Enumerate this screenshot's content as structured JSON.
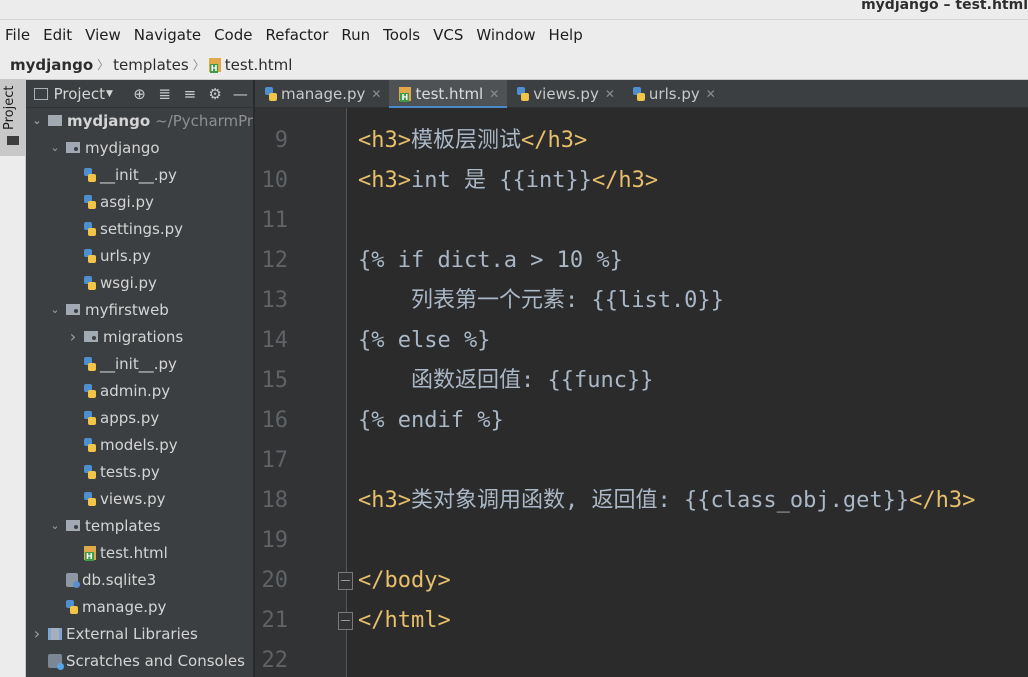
{
  "window": {
    "title": "mydjango – test.html"
  },
  "menu": [
    "File",
    "Edit",
    "View",
    "Navigate",
    "Code",
    "Refactor",
    "Run",
    "Tools",
    "VCS",
    "Window",
    "Help"
  ],
  "breadcrumb": {
    "project": "mydjango",
    "folder": "templates",
    "file": "test.html"
  },
  "toolstrip": {
    "project_label": "Project"
  },
  "project_panel": {
    "view_selector": "Project",
    "tree": [
      {
        "label": "mydjango",
        "path": "~/PycharmProj",
        "icon": "folder",
        "arrow": "expanded",
        "bold": true
      },
      {
        "label": "mydjango",
        "icon": "folder",
        "arrow": "expanded"
      },
      {
        "label": "__init__.py",
        "icon": "python-file"
      },
      {
        "label": "asgi.py",
        "icon": "python-file"
      },
      {
        "label": "settings.py",
        "icon": "python-file"
      },
      {
        "label": "urls.py",
        "icon": "python-file"
      },
      {
        "label": "wsgi.py",
        "icon": "python-file"
      },
      {
        "label": "myfirstweb",
        "icon": "folder",
        "arrow": "expanded"
      },
      {
        "label": "migrations",
        "icon": "folder",
        "arrow": "collapsed"
      },
      {
        "label": "__init__.py",
        "icon": "python-file"
      },
      {
        "label": "admin.py",
        "icon": "python-file"
      },
      {
        "label": "apps.py",
        "icon": "python-file"
      },
      {
        "label": "models.py",
        "icon": "python-file"
      },
      {
        "label": "tests.py",
        "icon": "python-file"
      },
      {
        "label": "views.py",
        "icon": "python-file"
      },
      {
        "label": "templates",
        "icon": "folder",
        "arrow": "expanded"
      },
      {
        "label": "test.html",
        "icon": "html-file"
      },
      {
        "label": "db.sqlite3",
        "icon": "database-file"
      },
      {
        "label": "manage.py",
        "icon": "python-file"
      },
      {
        "label": "External Libraries",
        "icon": "library",
        "arrow": "collapsed"
      },
      {
        "label": "Scratches and Consoles",
        "icon": "scratch"
      }
    ]
  },
  "tabs": [
    {
      "label": "manage.py",
      "icon": "python-file",
      "active": false
    },
    {
      "label": "test.html",
      "icon": "html-file",
      "active": true
    },
    {
      "label": "views.py",
      "icon": "python-file",
      "active": false
    },
    {
      "label": "urls.py",
      "icon": "python-file",
      "active": false
    }
  ],
  "editor": {
    "lines": [
      {
        "n": "9",
        "parts": [
          [
            "tag",
            "<h3>"
          ],
          [
            "text",
            "模板层测试"
          ],
          [
            "tag",
            "</h3>"
          ]
        ]
      },
      {
        "n": "10",
        "parts": [
          [
            "tag",
            "<h3>"
          ],
          [
            "text",
            "int 是 {{int}}"
          ],
          [
            "tag",
            "</h3>"
          ]
        ]
      },
      {
        "n": "11",
        "parts": []
      },
      {
        "n": "12",
        "parts": [
          [
            "text",
            "{% if dict.a > 10 %}"
          ]
        ]
      },
      {
        "n": "13",
        "parts": [
          [
            "text",
            "    列表第一个元素: {{list.0}}"
          ]
        ]
      },
      {
        "n": "14",
        "parts": [
          [
            "text",
            "{% else %}"
          ]
        ]
      },
      {
        "n": "15",
        "parts": [
          [
            "text",
            "    函数返回值: {{func}}"
          ]
        ]
      },
      {
        "n": "16",
        "parts": [
          [
            "text",
            "{% endif %}"
          ]
        ]
      },
      {
        "n": "17",
        "parts": []
      },
      {
        "n": "18",
        "parts": [
          [
            "tag",
            "<h3>"
          ],
          [
            "text",
            "类对象调用函数, 返回值: {{class_obj.get}}"
          ],
          [
            "tag",
            "</h3>"
          ]
        ]
      },
      {
        "n": "19",
        "parts": []
      },
      {
        "n": "20",
        "parts": [
          [
            "tag",
            "</body>"
          ]
        ],
        "fold": true
      },
      {
        "n": "21",
        "parts": [
          [
            "tag",
            "</html>"
          ]
        ],
        "fold": true
      },
      {
        "n": "22",
        "parts": []
      }
    ]
  },
  "colors": {
    "editor_bg": "#2b2b2b",
    "tag": "#e8bf6a",
    "text": "#a9b7c6",
    "line_number": "#606366",
    "tab_active_underline": "#4a88c7",
    "panel_bg": "#3c3f41"
  }
}
